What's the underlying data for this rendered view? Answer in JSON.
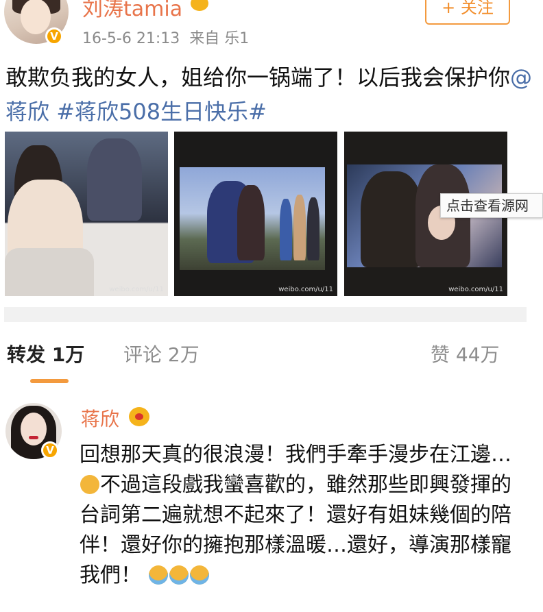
{
  "post": {
    "username": "刘涛tamia",
    "timestamp": "16-5-6 21:13",
    "source": "来自 乐1",
    "follow_label": "+ 关注",
    "text_main": "敢欺负我的女人，姐给你一锅端了！以后我会保护你",
    "mention": "@蒋欣",
    "hashtag": " #蒋欣508生日快乐#",
    "image_watermark": "weibo.com/u/11",
    "tooltip": "点击查看源网"
  },
  "actions": {
    "forward": "转发 1万",
    "comment": "评论 2万",
    "like": "赞 44万"
  },
  "comment": {
    "username": "蒋欣",
    "text_part1": "回想那天真的很浪漫！我們手牽手漫步在江邊…",
    "text_part2": "不過這段戲我蠻喜歡的，雖然那些即興發揮的台詞第二遍就想不起來了！還好有姐妹幾個的陪伴！還好你的擁抱那樣溫暖…還好，導演那樣寵我們！"
  },
  "colors": {
    "username": "#e8744a",
    "link": "#4a6ea8",
    "accent": "#f39a3e",
    "verified_badge": "#f7a500"
  },
  "icons": [
    "verified-icon",
    "crown-icon",
    "sleepy-emoji-icon",
    "crying-emoji-icon"
  ]
}
